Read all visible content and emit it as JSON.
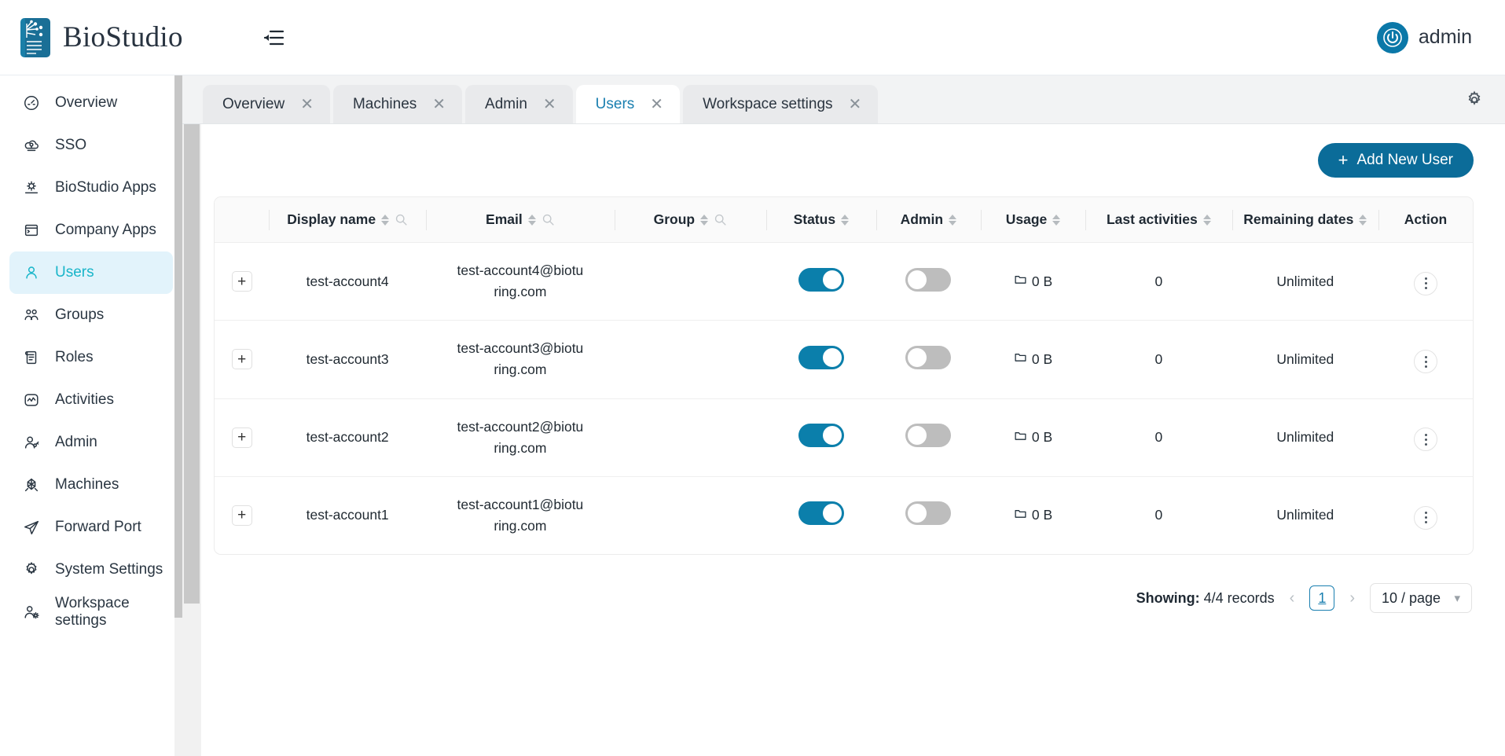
{
  "app": {
    "brand_name": "BioStudio",
    "logo_icon": "biostudio-document-circuit-logo",
    "menu_toggle_icon": "collapse-menu-icon",
    "user_name": "admin",
    "avatar_icon": "power-user-avatar-icon",
    "accent_color": "#0b6c99",
    "active_nav_color": "#18b5c9",
    "active_nav_bg": "#e2f3fb"
  },
  "sidebar": {
    "items": [
      {
        "label": "Overview",
        "icon": "gauge-icon",
        "active": false
      },
      {
        "label": "SSO",
        "icon": "cloud-key-icon",
        "active": false
      },
      {
        "label": "BioStudio Apps",
        "icon": "gear-laptop-icon",
        "active": false
      },
      {
        "label": "Company Apps",
        "icon": "window-terminal-icon",
        "active": false
      },
      {
        "label": "Users",
        "icon": "user-icon",
        "active": true
      },
      {
        "label": "Groups",
        "icon": "users-group-icon",
        "active": false
      },
      {
        "label": "Roles",
        "icon": "scroll-list-icon",
        "active": false
      },
      {
        "label": "Activities",
        "icon": "activity-pulse-icon",
        "active": false
      },
      {
        "label": "Admin",
        "icon": "user-key-icon",
        "active": false
      },
      {
        "label": "Machines",
        "icon": "machine-node-icon",
        "active": false
      },
      {
        "label": "Forward Port",
        "icon": "paper-plane-icon",
        "active": false
      },
      {
        "label": "System Settings",
        "icon": "gear-icon",
        "active": false
      },
      {
        "label": "Workspace settings",
        "icon": "user-gear-icon",
        "active": false
      }
    ]
  },
  "tabs": {
    "items": [
      {
        "label": "Overview",
        "active": false,
        "close_icon": "close-icon"
      },
      {
        "label": "Machines",
        "active": false,
        "close_icon": "close-icon"
      },
      {
        "label": "Admin",
        "active": false,
        "close_icon": "close-icon"
      },
      {
        "label": "Users",
        "active": true,
        "close_icon": "close-icon"
      },
      {
        "label": "Workspace settings",
        "active": false,
        "close_icon": "close-icon"
      }
    ],
    "settings_icon": "gear-icon"
  },
  "toolbar": {
    "add_user_label": "Add New User",
    "add_user_icon": "plus-icon"
  },
  "table": {
    "columns": [
      {
        "label": "Display name",
        "sortable": true,
        "searchable": true
      },
      {
        "label": "Email",
        "sortable": true,
        "searchable": true
      },
      {
        "label": "Group",
        "sortable": true,
        "searchable": true
      },
      {
        "label": "Status",
        "sortable": true,
        "searchable": false
      },
      {
        "label": "Admin",
        "sortable": true,
        "searchable": false
      },
      {
        "label": "Usage",
        "sortable": true,
        "searchable": false
      },
      {
        "label": "Last activities",
        "sortable": true,
        "searchable": false
      },
      {
        "label": "Remaining dates",
        "sortable": true,
        "searchable": false
      },
      {
        "label": "Action",
        "sortable": false,
        "searchable": false
      }
    ],
    "expand_icon": "plus-icon",
    "usage_icon": "folder-icon",
    "action_icon": "kebab-menu-icon",
    "rows": [
      {
        "display_name": "test-account4",
        "email": "test-account4@biotu ring.com",
        "email_line1": "test-account4@biotu",
        "email_line2": "ring.com",
        "group": "",
        "status_on": true,
        "admin_on": false,
        "usage": "0 B",
        "last_activities": "0",
        "remaining_dates": "Unlimited"
      },
      {
        "display_name": "test-account3",
        "email": "test-account3@biotu ring.com",
        "email_line1": "test-account3@biotu",
        "email_line2": "ring.com",
        "group": "",
        "status_on": true,
        "admin_on": false,
        "usage": "0 B",
        "last_activities": "0",
        "remaining_dates": "Unlimited"
      },
      {
        "display_name": "test-account2",
        "email": "test-account2@biotu ring.com",
        "email_line1": "test-account2@biotu",
        "email_line2": "ring.com",
        "group": "",
        "status_on": true,
        "admin_on": false,
        "usage": "0 B",
        "last_activities": "0",
        "remaining_dates": "Unlimited"
      },
      {
        "display_name": "test-account1",
        "email": "test-account1@biotu ring.com",
        "email_line1": "test-account1@biotu",
        "email_line2": "ring.com",
        "group": "",
        "status_on": true,
        "admin_on": false,
        "usage": "0 B",
        "last_activities": "0",
        "remaining_dates": "Unlimited"
      }
    ]
  },
  "pagination": {
    "showing_label": "Showing:",
    "showing_value": "4/4 records",
    "prev_icon": "chevron-left-icon",
    "next_icon": "chevron-right-icon",
    "current_page": "1",
    "per_page": "10 / page",
    "per_page_icon": "chevron-down-icon"
  }
}
